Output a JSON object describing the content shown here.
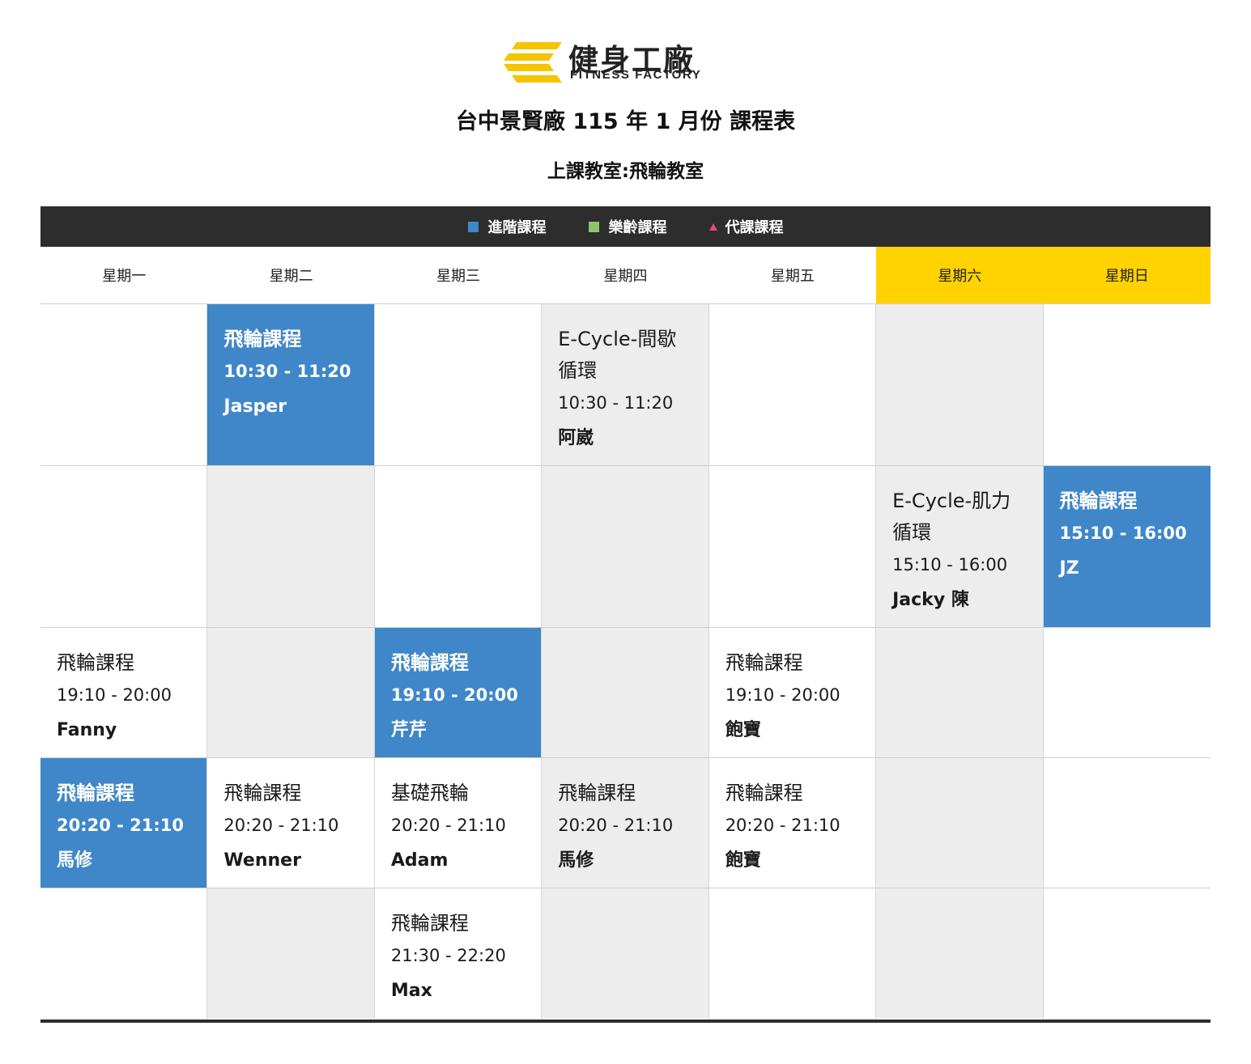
{
  "brand": {
    "name_cn": "健身工廠",
    "name_en": "FITNESS FACTORY",
    "logo_color": "#f5c400"
  },
  "header": {
    "title": "台中景賢廠 115 年 1 月份 課程表",
    "room": "上課教室:飛輪教室"
  },
  "legend": [
    {
      "label": "進階課程",
      "color": "#3f87c8",
      "shape": "square"
    },
    {
      "label": "樂齡課程",
      "color": "#8cc56e",
      "shape": "square"
    },
    {
      "label": "代課課程",
      "color": "#e8457a",
      "shape": "triangle"
    }
  ],
  "days": [
    "星期一",
    "星期二",
    "星期三",
    "星期四",
    "星期五",
    "星期六",
    "星期日"
  ],
  "schedule": [
    [
      {
        "bg": "white"
      },
      {
        "bg": "blue",
        "name": "飛輪課程",
        "time": "10:30 - 11:20",
        "instructor": "Jasper"
      },
      {
        "bg": "white"
      },
      {
        "bg": "gray",
        "name": "E-Cycle-間歇循環",
        "time": "10:30 - 11:20",
        "instructor": "阿崴"
      },
      {
        "bg": "white"
      },
      {
        "bg": "gray"
      },
      {
        "bg": "white"
      }
    ],
    [
      {
        "bg": "white"
      },
      {
        "bg": "gray"
      },
      {
        "bg": "white"
      },
      {
        "bg": "gray"
      },
      {
        "bg": "white"
      },
      {
        "bg": "gray",
        "name": "E-Cycle-肌力循環",
        "time": "15:10 - 16:00",
        "instructor": "Jacky 陳"
      },
      {
        "bg": "blue",
        "name": "飛輪課程",
        "time": "15:10 - 16:00",
        "instructor": "JZ"
      }
    ],
    [
      {
        "bg": "white",
        "name": "飛輪課程",
        "time": "19:10 - 20:00",
        "instructor": "Fanny"
      },
      {
        "bg": "gray"
      },
      {
        "bg": "blue",
        "name": "飛輪課程",
        "time": "19:10 - 20:00",
        "instructor": "芹芹"
      },
      {
        "bg": "gray"
      },
      {
        "bg": "white",
        "name": "飛輪課程",
        "time": "19:10 - 20:00",
        "instructor": "飽寶"
      },
      {
        "bg": "gray"
      },
      {
        "bg": "white"
      }
    ],
    [
      {
        "bg": "blue",
        "name": "飛輪課程",
        "time": "20:20 - 21:10",
        "instructor": "馬修"
      },
      {
        "bg": "white",
        "name": "飛輪課程",
        "time": "20:20 - 21:10",
        "instructor": "Wenner"
      },
      {
        "bg": "white",
        "name": "基礎飛輪",
        "time": "20:20 - 21:10",
        "instructor": "Adam"
      },
      {
        "bg": "gray",
        "name": "飛輪課程",
        "time": "20:20 - 21:10",
        "instructor": "馬修"
      },
      {
        "bg": "white",
        "name": "飛輪課程",
        "time": "20:20 - 21:10",
        "instructor": "飽寶"
      },
      {
        "bg": "gray"
      },
      {
        "bg": "white"
      }
    ],
    [
      {
        "bg": "white"
      },
      {
        "bg": "gray"
      },
      {
        "bg": "white",
        "name": "飛輪課程",
        "time": "21:30 - 22:20",
        "instructor": "Max"
      },
      {
        "bg": "gray"
      },
      {
        "bg": "white"
      },
      {
        "bg": "gray"
      },
      {
        "bg": "white"
      }
    ]
  ]
}
